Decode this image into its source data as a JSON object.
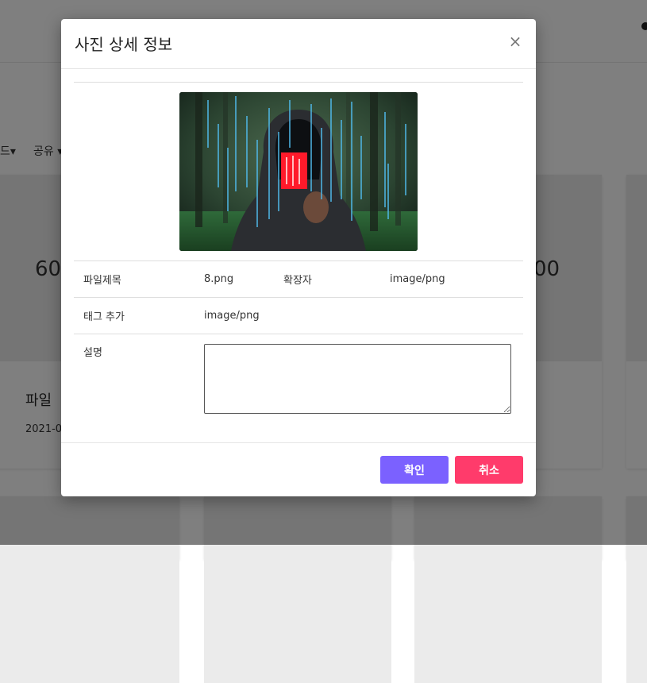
{
  "background": {
    "filters": [
      "드▾",
      "공유 ▾"
    ],
    "cards": [
      {
        "thumb_text": "60",
        "title": "파일",
        "date": "2021-0"
      },
      {
        "thumb_text": "00",
        "title": "",
        "date": ""
      }
    ]
  },
  "modal": {
    "title": "사진 상세 정보",
    "close_symbol": "×",
    "image_alt": "hooded figure holding red card with binary code",
    "rows": {
      "file_title_label": "파일제목",
      "file_title_value": "8.png",
      "extension_label": "확장자",
      "extension_value": "image/png",
      "tag_label": "태그 추가",
      "tag_value": "image/png",
      "description_label": "설명",
      "description_value": ""
    },
    "buttons": {
      "confirm_label": "확인",
      "cancel_label": "취소"
    }
  },
  "colors": {
    "confirm": "#7b61ff",
    "cancel": "#ff3b6b",
    "overlay": "rgba(0,0,0,0.5)"
  },
  "icons": {
    "close": "close-icon"
  }
}
